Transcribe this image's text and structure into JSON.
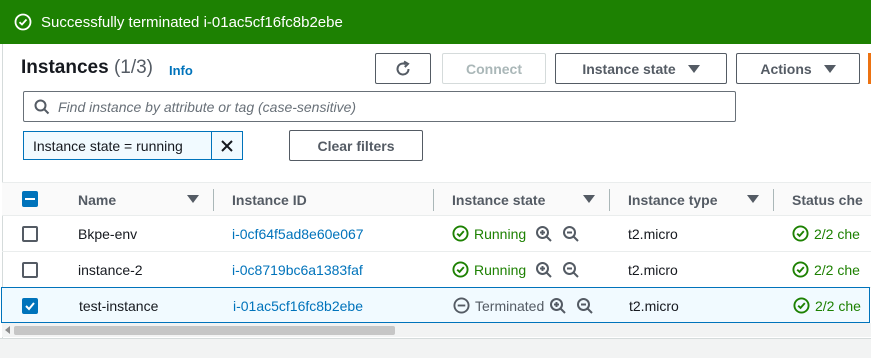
{
  "flash": {
    "message": "Successfully terminated i-01ac5cf16fc8b2ebe",
    "color": "#1d8102"
  },
  "header": {
    "title": "Instances",
    "count": "(1/3)",
    "info": "Info"
  },
  "toolbar": {
    "refresh_icon": "refresh-icon",
    "connect": "Connect",
    "instance_state": "Instance state",
    "actions": "Actions"
  },
  "search": {
    "placeholder": "Find instance by attribute or tag (case-sensitive)"
  },
  "filter": {
    "token": "Instance state = running",
    "clear": "Clear filters"
  },
  "table": {
    "columns": [
      "Name",
      "Instance ID",
      "Instance state",
      "Instance type",
      "Status che"
    ],
    "rows": [
      {
        "name": "Bkpe-env",
        "id": "i-0cf64f5ad8e60e067",
        "state": "Running",
        "type": "t2.micro",
        "status": "2/2 che",
        "selected": false
      },
      {
        "name": "instance-2",
        "id": "i-0c8719bc6a1383faf",
        "state": "Running",
        "type": "t2.micro",
        "status": "2/2 che",
        "selected": false
      },
      {
        "name": "test-instance",
        "id": "i-01ac5cf16fc8b2ebe",
        "state": "Terminated",
        "type": "t2.micro",
        "status": "2/2 che",
        "selected": true
      }
    ]
  },
  "colors": {
    "link": "#0073bb",
    "success": "#1d8102",
    "accent": "#ec7211"
  }
}
